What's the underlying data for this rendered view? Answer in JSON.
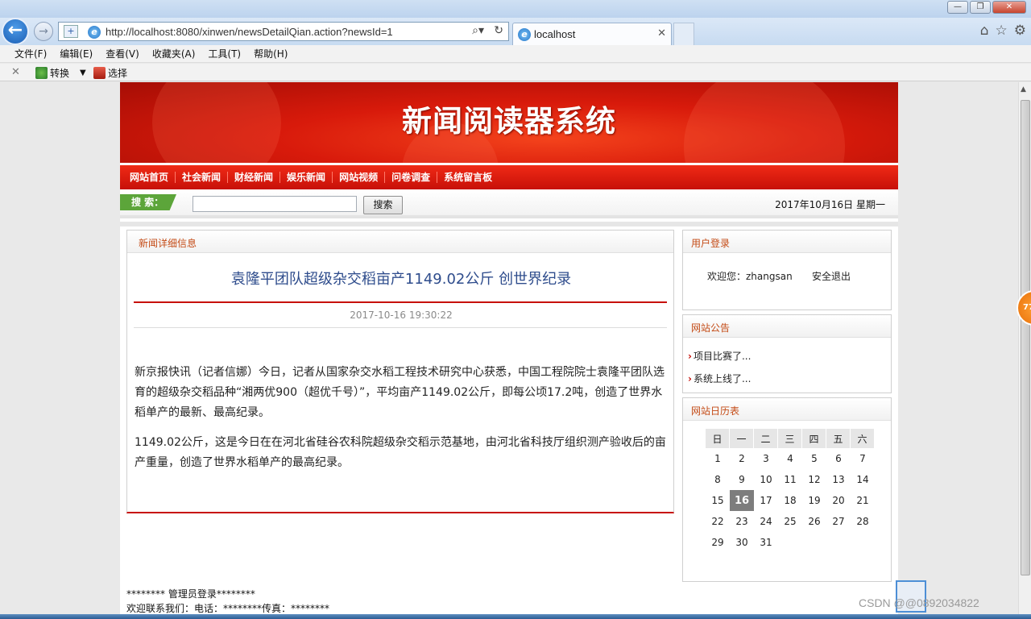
{
  "browser": {
    "url": "http://localhost:8080/xinwen/newsDetailQian.action?newsId=1",
    "tab_title": "localhost",
    "menu": [
      "文件(F)",
      "编辑(E)",
      "查看(V)",
      "收藏夹(A)",
      "工具(T)",
      "帮助(H)"
    ],
    "commands": {
      "convert": "转换",
      "select": "选择"
    }
  },
  "site": {
    "title": "新闻阅读器系统",
    "nav": [
      "网站首页",
      "社会新闻",
      "财经新闻",
      "娱乐新闻",
      "网站视频",
      "问卷调查",
      "系统留言板"
    ],
    "search": {
      "label": "搜 索：",
      "input_value": "",
      "button": "搜索",
      "date": "2017年10月16日 星期一"
    }
  },
  "article": {
    "panel_title": "新闻详细信息",
    "title": "袁隆平团队超级杂交稻亩产1149.02公斤 创世界纪录",
    "time": "2017-10-16 19:30:22",
    "paragraphs": [
      "新京报快讯（记者信娜）今日，记者从国家杂交水稻工程技术研究中心获悉，中国工程院院士袁隆平团队选育的超级杂交稻品种“湘两优900（超优千号）”，平均亩产1149.02公斤，即每公顷17.2吨，创造了世界水稻单产的最新、最高纪录。",
      "1149.02公斤，这是今日在在河北省硅谷农科院超级杂交稻示范基地，由河北省科技厅组织测产验收后的亩产重量，创造了世界水稻单产的最高纪录。"
    ]
  },
  "sidebar": {
    "login": {
      "title": "用户登录",
      "welcome": "欢迎您：zhangsan",
      "logout": "安全退出"
    },
    "notices": {
      "title": "网站公告",
      "items": [
        "项目比赛了...",
        "系统上线了..."
      ]
    },
    "calendar": {
      "title": "网站日历表",
      "weekdays": [
        "日",
        "一",
        "二",
        "三",
        "四",
        "五",
        "六"
      ],
      "weeks": [
        [
          "1",
          "2",
          "3",
          "4",
          "5",
          "6",
          "7"
        ],
        [
          "8",
          "9",
          "10",
          "11",
          "12",
          "13",
          "14"
        ],
        [
          "15",
          "16",
          "17",
          "18",
          "19",
          "20",
          "21"
        ],
        [
          "22",
          "23",
          "24",
          "25",
          "26",
          "27",
          "28"
        ],
        [
          "29",
          "30",
          "31",
          "",
          "",
          "",
          ""
        ]
      ],
      "today": "16"
    }
  },
  "footer": {
    "admin": "******** 管理员登录********",
    "contact": "欢迎联系我们：电话：********传真：********"
  },
  "overlay": {
    "badge": "77",
    "watermark": "CSDN @@0892034822"
  }
}
